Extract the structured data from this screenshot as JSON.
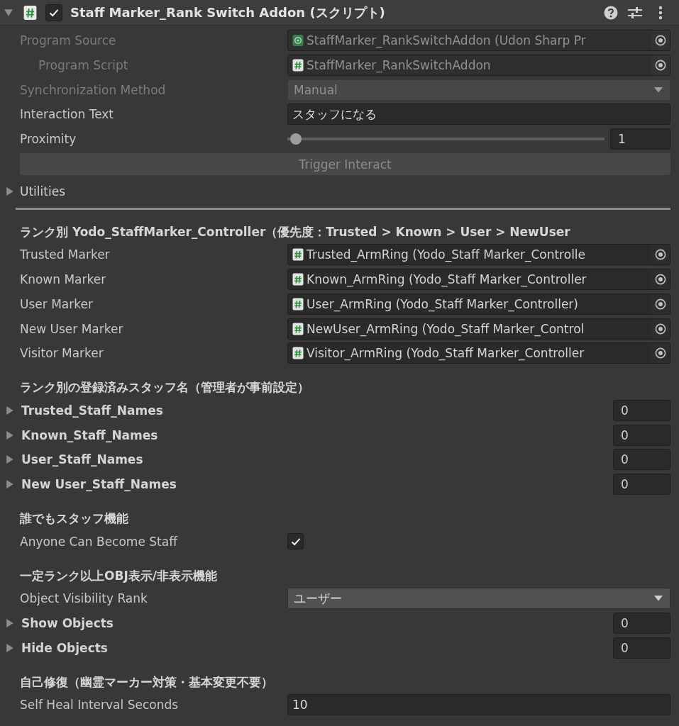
{
  "component": {
    "title": "Staff Marker_Rank Switch Addon (スクリプト)",
    "expanded": true,
    "enabled": true
  },
  "top_fields": [
    {
      "kind": "asset",
      "label": "Program Source",
      "value": "StaffMarker_RankSwitchAddon (Udon Sharp Pr",
      "disabled": true,
      "children": [
        {
          "kind": "script",
          "label": "Program Script",
          "value": "StaffMarker_RankSwitchAddon",
          "disabled": true
        }
      ]
    },
    {
      "kind": "dropdown",
      "label": "Synchronization Method",
      "value": "Manual",
      "disabled": true
    },
    {
      "kind": "text",
      "label": "Interaction Text",
      "value": "スタッフになる",
      "disabled": false
    },
    {
      "kind": "slider",
      "label": "Proximity",
      "level": 0.01,
      "value": "1",
      "disabled": false
    },
    {
      "kind": "button",
      "label": "Trigger Interact",
      "disabled": true
    },
    {
      "kind": "foldout",
      "label": "Utilities",
      "expanded": false,
      "disabled": false
    }
  ],
  "sections": [
    {
      "title": "ランク別 Yodo_StaffMarker_Controller（優先度：Trusted > Known > User > NewUser",
      "fields": [
        {
          "kind": "script",
          "label": "Trusted Marker",
          "value": "Trusted_ArmRing (Yodo_Staff Marker_Controlle",
          "disabled": false
        },
        {
          "kind": "script",
          "label": "Known Marker",
          "value": "Known_ArmRing (Yodo_Staff Marker_Controller",
          "disabled": false
        },
        {
          "kind": "script",
          "label": "User Marker",
          "value": "User_ArmRing (Yodo_Staff Marker_Controller)",
          "disabled": false
        },
        {
          "kind": "script",
          "label": "New User Marker",
          "value": "NewUser_ArmRing (Yodo_Staff Marker_Control",
          "disabled": false
        },
        {
          "kind": "script",
          "label": "Visitor Marker",
          "value": "Visitor_ArmRing (Yodo_Staff Marker_Controller",
          "disabled": false
        }
      ]
    },
    {
      "title": "ランク別の登録済みスタッフ名（管理者が事前設定）",
      "fields": [
        {
          "kind": "array",
          "label": "Trusted_Staff_Names",
          "size": "0",
          "expanded": false,
          "disabled": false
        },
        {
          "kind": "array",
          "label": "Known_Staff_Names",
          "size": "0",
          "expanded": false,
          "disabled": false
        },
        {
          "kind": "array",
          "label": "User_Staff_Names",
          "size": "0",
          "expanded": false,
          "disabled": false
        },
        {
          "kind": "array",
          "label": "New User_Staff_Names",
          "size": "0",
          "expanded": false,
          "disabled": false
        }
      ]
    },
    {
      "title": "誰でもスタッフ機能",
      "fields": [
        {
          "kind": "checkbox",
          "label": "Anyone Can Become Staff",
          "checked": true,
          "disabled": false
        }
      ]
    },
    {
      "title": "一定ランク以上OBJ表示/非表示機能",
      "fields": [
        {
          "kind": "dropdown",
          "label": "Object Visibility Rank",
          "value": "ユーザー",
          "disabled": false
        },
        {
          "kind": "array",
          "label": "Show Objects",
          "size": "0",
          "expanded": false,
          "disabled": false
        },
        {
          "kind": "array",
          "label": "Hide Objects",
          "size": "0",
          "expanded": false,
          "disabled": false
        }
      ]
    },
    {
      "title": "自己修復（幽霊マーカー対策・基本変更不要）",
      "fields": [
        {
          "kind": "text",
          "label": "Self Heal Interval Seconds",
          "value": "10",
          "disabled": false
        }
      ]
    }
  ]
}
